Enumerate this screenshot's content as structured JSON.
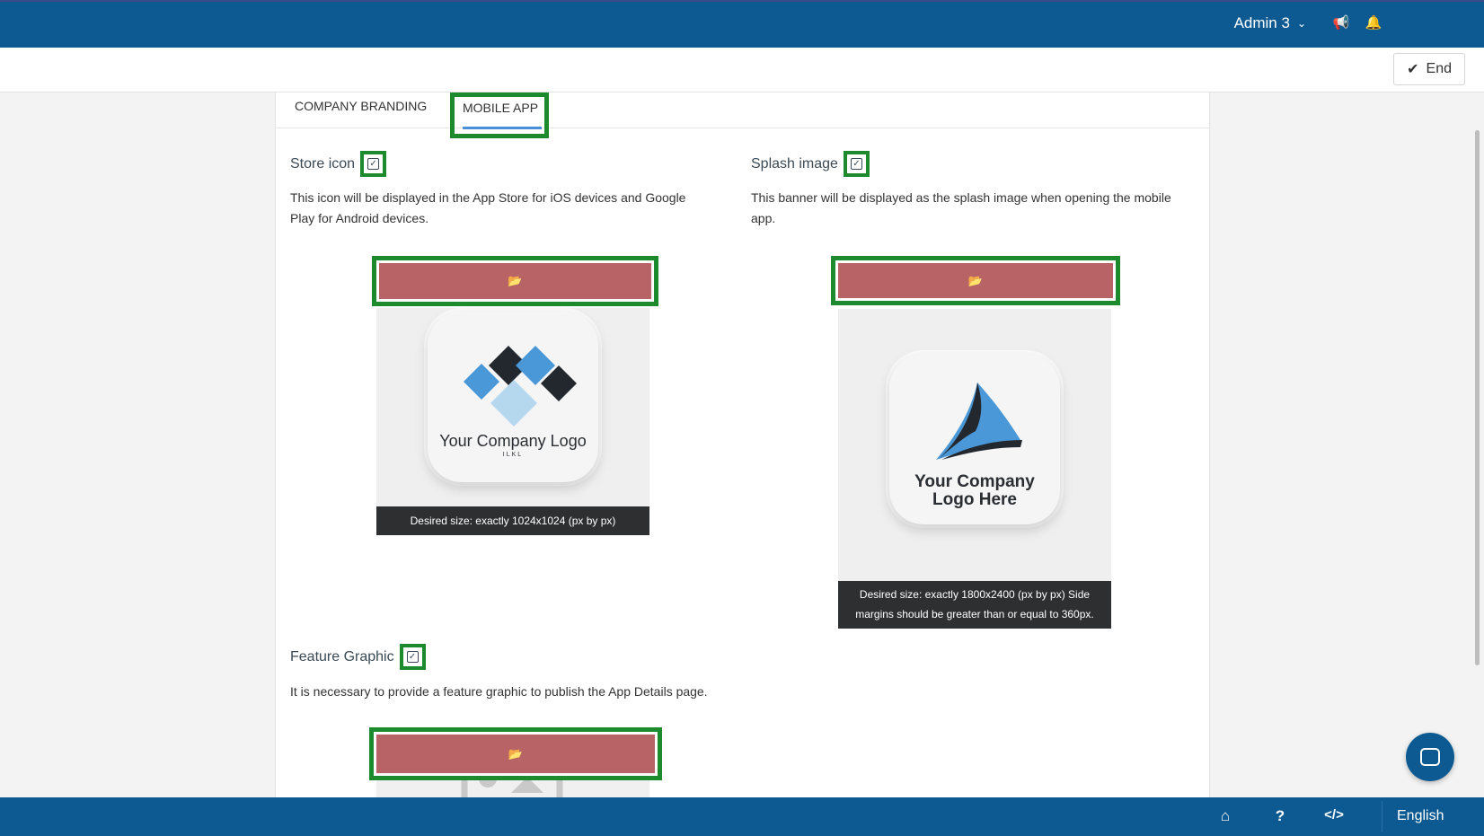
{
  "header": {
    "user_label": "Admin 3",
    "icons": [
      "chevron-down-icon",
      "megaphone-icon",
      "bell-icon"
    ]
  },
  "toolbar": {
    "end_label": "End"
  },
  "tabs": [
    {
      "label": "COMPANY BRANDING",
      "active": false
    },
    {
      "label": "MOBILE APP",
      "active": true
    }
  ],
  "store_icon": {
    "title": "Store icon",
    "description": "This icon will be displayed in the App Store for iOS devices and Google Play for Android devices.",
    "logo_text": "Your Company Logo",
    "logo_subtext": "ILKL",
    "caption": "Desired size: exactly 1024x1024 (px by px)"
  },
  "splash_image": {
    "title": "Splash image",
    "description": "This banner will be displayed as the splash image when opening the mobile app.",
    "logo_text_line1": "Your Company",
    "logo_text_line2": "Logo Here",
    "caption": "Desired size: exactly 1800x2400 (px by px) Side margins should be greater than or equal to 360px."
  },
  "feature_graphic": {
    "title": "Feature Graphic",
    "description": "It is necessary to provide a feature graphic to publish the App Details page."
  },
  "footer": {
    "language": "English",
    "icons": [
      "home-icon",
      "help-icon",
      "code-icon"
    ]
  },
  "colors": {
    "brand_blue": "#0d5a92",
    "highlight_green": "#1e8a2e",
    "upload_red": "#b86466"
  }
}
